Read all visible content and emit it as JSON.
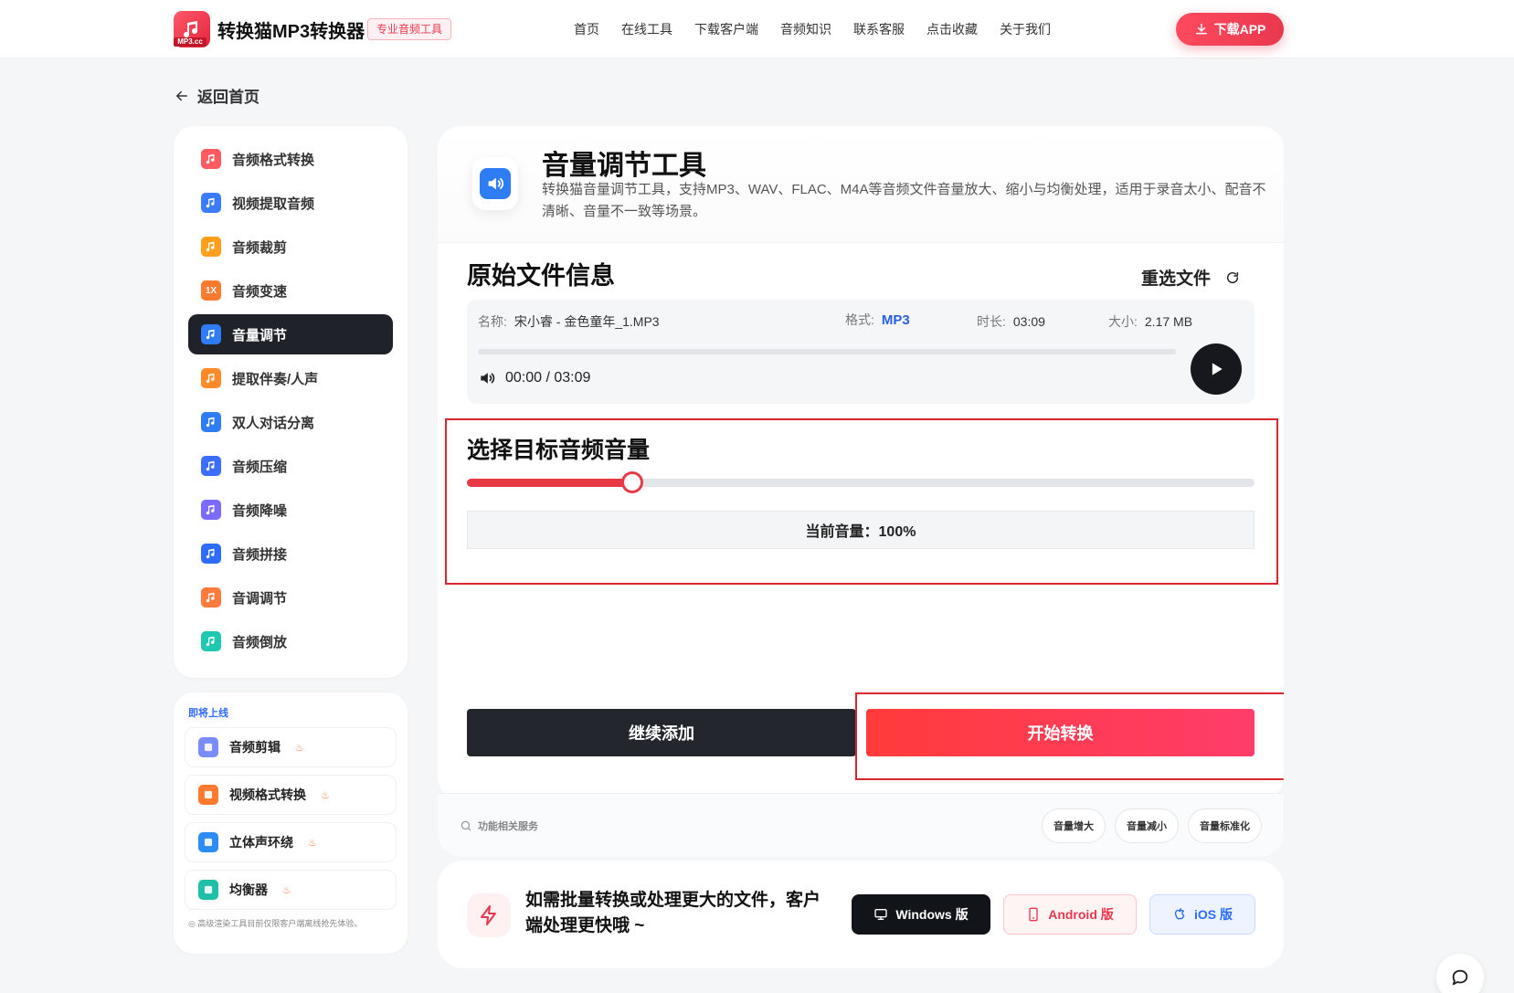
{
  "header": {
    "logo_badge": "MP3.cc",
    "app_title": "转换猫MP3转换器",
    "pro_badge": "专业音频工具",
    "nav": [
      "首页",
      "在线工具",
      "下载客户端",
      "音频知识",
      "联系客服",
      "点击收藏",
      "关于我们"
    ],
    "download_app": "下载APP"
  },
  "back_link": "返回首页",
  "sidebar": {
    "items": [
      {
        "label": "音频格式转换",
        "icon": "format-convert-icon",
        "color": "#ff5a5f"
      },
      {
        "label": "视频提取音频",
        "icon": "video-extract-icon",
        "color": "#3b7bff"
      },
      {
        "label": "音频裁剪",
        "icon": "audio-cut-icon",
        "color": "#ff9f1c"
      },
      {
        "label": "音频变速",
        "icon": "speed-icon",
        "color": "#ff7a2e",
        "glyph": "1X"
      },
      {
        "label": "音量调节",
        "icon": "volume-icon",
        "color": "#2e7cf6",
        "active": true
      },
      {
        "label": "提取伴奏/人声",
        "icon": "vocal-icon",
        "color": "#ff8a2a"
      },
      {
        "label": "双人对话分离",
        "icon": "dialog-icon",
        "color": "#2e7cf6"
      },
      {
        "label": "音频压缩",
        "icon": "compress-icon",
        "color": "#3b6dff"
      },
      {
        "label": "音频降噪",
        "icon": "denoise-icon",
        "color": "#7b6bff"
      },
      {
        "label": "音频拼接",
        "icon": "merge-icon",
        "color": "#2e6bff"
      },
      {
        "label": "音调调节",
        "icon": "pitch-icon",
        "color": "#ff7a3d"
      },
      {
        "label": "音频倒放",
        "icon": "reverse-icon",
        "color": "#1fc8b0"
      }
    ]
  },
  "soon": {
    "title": "即将上线",
    "items": [
      {
        "label": "音频剪辑",
        "icon": "scissors-icon",
        "color": "#7b8cff"
      },
      {
        "label": "视频格式转换",
        "icon": "video-play-icon",
        "color": "#ff7a2e"
      },
      {
        "label": "立体声环绕",
        "icon": "cube-icon",
        "color": "#2e8cf6"
      },
      {
        "label": "均衡器",
        "icon": "equalizer-icon",
        "color": "#1fbfa8"
      }
    ],
    "fire": "♨",
    "note": "◎ 高级渲染工具目前仅限客户端离线抢先体验。"
  },
  "tool": {
    "title": "音量调节工具",
    "desc": "转换猫音量调节工具，支持MP3、WAV、FLAC、M4A等音频文件音量放大、缩小与均衡处理，适用于录音太小、配音不清晰、音量不一致等场景。"
  },
  "file": {
    "section_title": "原始文件信息",
    "reselect": "重选文件",
    "name_label": "名称:",
    "name": "宋小睿 - 金色童年_1.MP3",
    "format_label": "格式:",
    "format": "MP3",
    "duration_label": "时长:",
    "duration": "03:09",
    "size_label": "大小:",
    "size": "2.17 MB",
    "time": "00:00 / 03:09",
    "progress": 0
  },
  "volume": {
    "section_title": "选择目标音频音量",
    "current": "当前音量：100%",
    "slider_fraction": 0.21
  },
  "actions": {
    "continue": "继续添加",
    "start": "开始转换"
  },
  "related": {
    "label": "功能相关服务",
    "chips": [
      "音量增大",
      "音量减小",
      "音量标准化"
    ]
  },
  "promo": {
    "text": "如需批量转换或处理更大的文件，客户端处理更快哦 ~",
    "windows": "Windows 版",
    "android": "Android 版",
    "ios": "iOS 版"
  },
  "colors": {
    "accent": "#e8384f",
    "primary_dark": "#1f2229",
    "link_blue": "#2b5fe0"
  }
}
